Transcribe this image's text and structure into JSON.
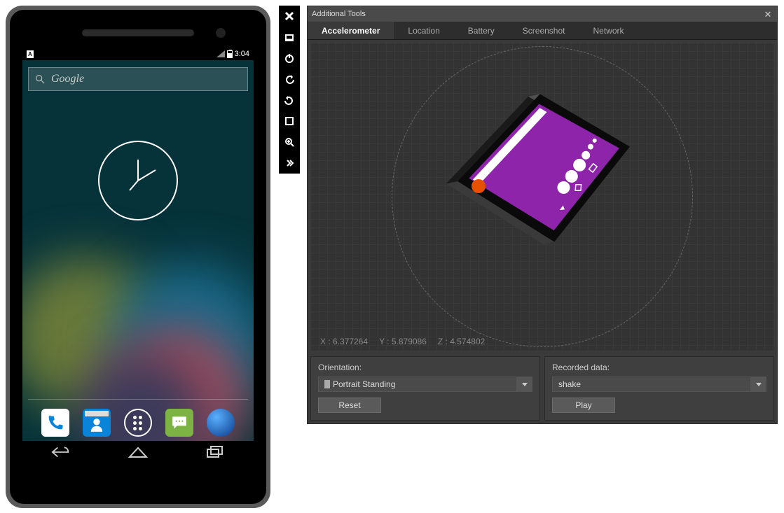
{
  "phone": {
    "status": {
      "keyboard_indicator": "A",
      "time": "3:04"
    },
    "search_placeholder": "Google",
    "nav": {
      "back": "back-icon",
      "home": "home-icon",
      "recent": "recent-icon"
    }
  },
  "toolbar": {
    "items": [
      "close-icon",
      "window-icon",
      "power-icon",
      "rotate-left-icon",
      "rotate-right-icon",
      "fit-screen-icon",
      "zoom-icon",
      "more-icon"
    ]
  },
  "panel": {
    "title": "Additional Tools",
    "tabs": [
      "Accelerometer",
      "Location",
      "Battery",
      "Screenshot",
      "Network"
    ],
    "active_tab": 0,
    "coords": {
      "x_label": "X : 6.377264",
      "y_label": "Y : 5.879086",
      "z_label": "Z : 4.574802"
    },
    "orientation": {
      "label": "Orientation:",
      "value": "Portrait Standing",
      "button": "Reset"
    },
    "recorded": {
      "label": "Recorded data:",
      "value": "shake",
      "button": "Play"
    }
  }
}
